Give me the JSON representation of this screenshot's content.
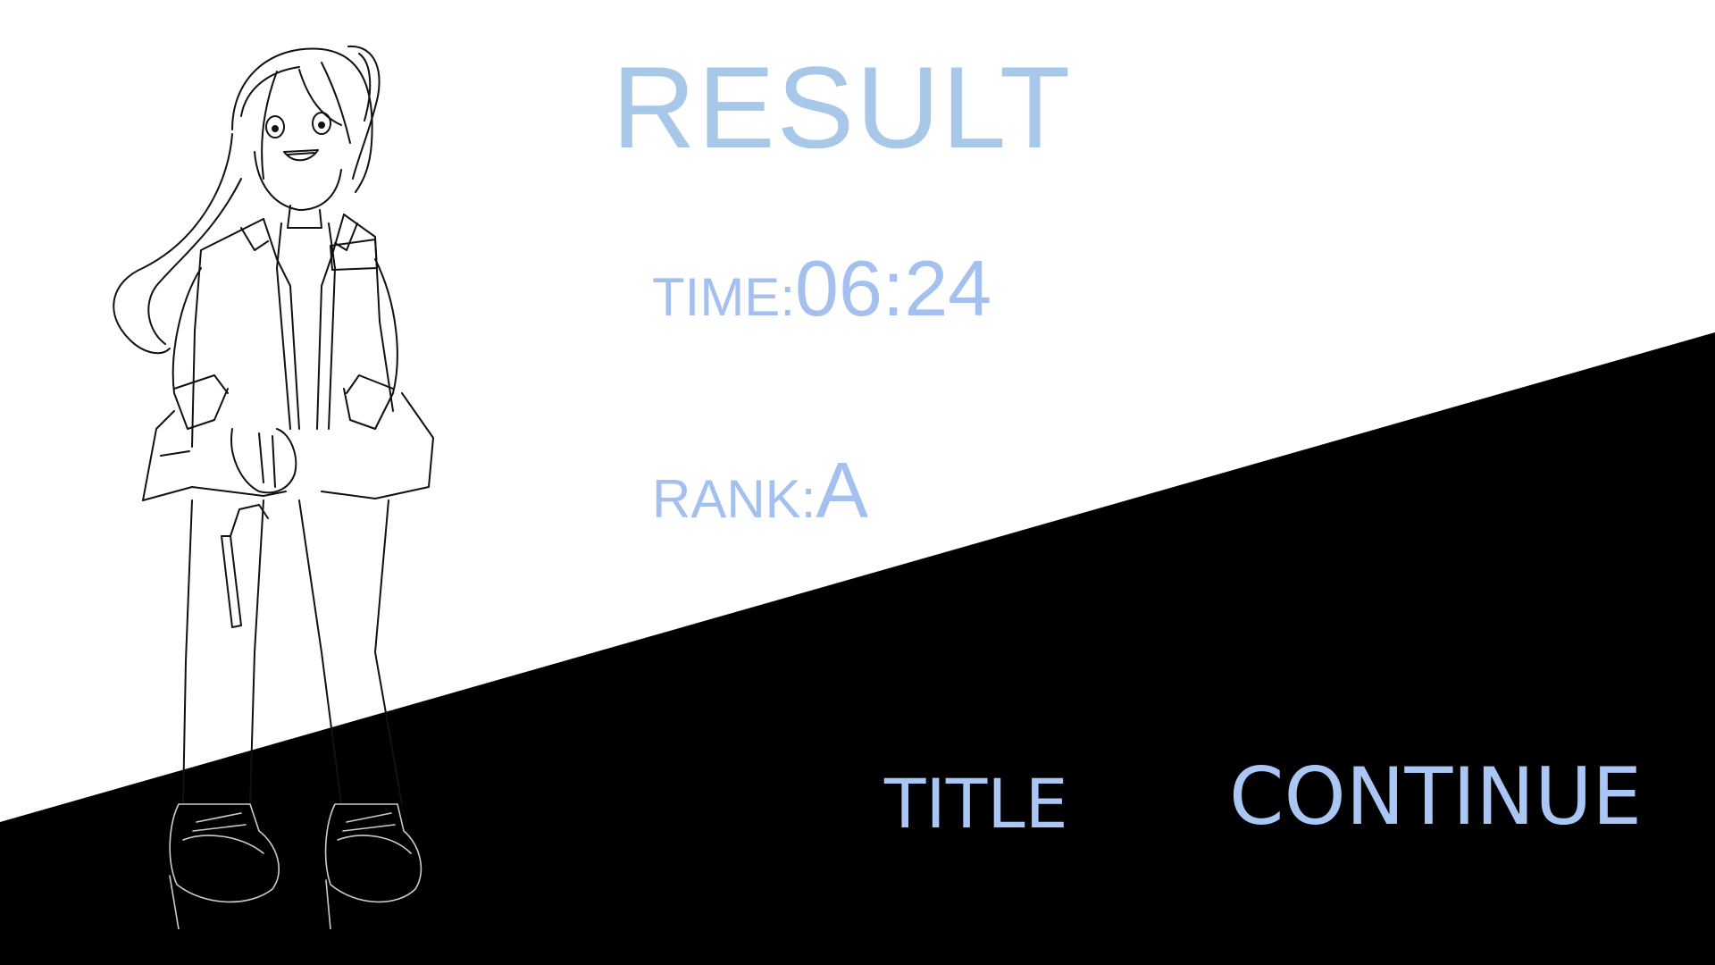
{
  "result": {
    "heading": "RESULT",
    "time_label": "TIME:",
    "time_value": "06:24",
    "rank_label": "RANK:",
    "rank_value": "A"
  },
  "menu": {
    "title_label": "TITLE",
    "continue_label": "CONTINUE"
  },
  "colors": {
    "text_accent": "#a3c0ef",
    "background": "#ffffff",
    "wedge": "#000000"
  },
  "icons": {
    "character": "sketch-girl-with-pistol"
  }
}
